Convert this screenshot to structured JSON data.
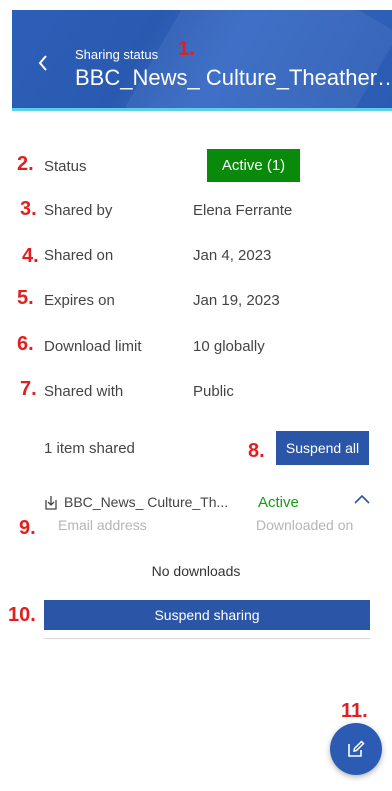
{
  "header": {
    "subtitle": "Sharing status",
    "title": "BBC_News_ Culture_Theather_..."
  },
  "markers": [
    "1.",
    "2.",
    "3.",
    "4.",
    "5.",
    "6.",
    "7.",
    "8.",
    "9.",
    "10.",
    "11."
  ],
  "details": {
    "status_label": "Status",
    "status_value": "Active (1)",
    "shared_by_label": "Shared by",
    "shared_by_value": "Elena Ferrante",
    "shared_on_label": "Shared on",
    "shared_on_value": "Jan 4, 2023",
    "expires_on_label": "Expires on",
    "expires_on_value": "Jan 19, 2023",
    "download_limit_label": "Download limit",
    "download_limit_value": "10 globally",
    "shared_with_label": "Shared with",
    "shared_with_value": "Public"
  },
  "items": {
    "count_label": "1 item shared",
    "suspend_all_label": "Suspend all",
    "file_name": "BBC_News_ Culture_Th...",
    "file_status": "Active",
    "col_email": "Email address",
    "col_downloaded": "Downloaded on",
    "empty_text": "No downloads",
    "suspend_sharing_label": "Suspend sharing"
  },
  "colors": {
    "header_blue": "#2c5fb8",
    "accent_cyan": "#5ed0e6",
    "active_green": "#0a8a0a",
    "button_blue": "#2b56a8",
    "marker_red": "#e02020"
  },
  "icons": [
    "chevron-left-icon",
    "download-file-icon",
    "chevron-up-icon",
    "edit-icon"
  ]
}
